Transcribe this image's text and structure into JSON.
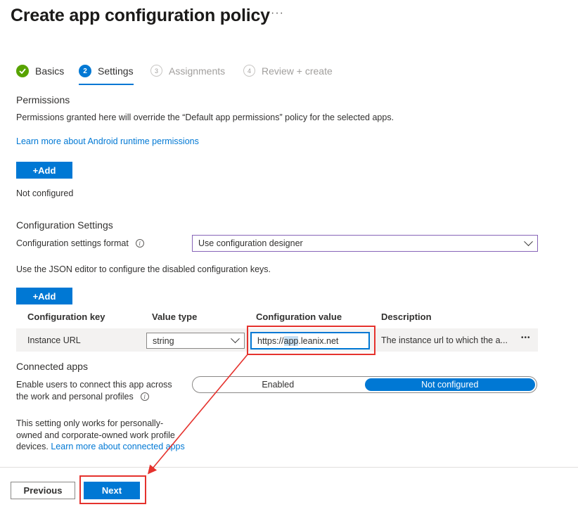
{
  "header": {
    "title": "Create app configuration policy",
    "more_label": "···"
  },
  "steps": [
    {
      "number": "✓",
      "label": "Basics",
      "state": "done"
    },
    {
      "number": "2",
      "label": "Settings",
      "state": "active"
    },
    {
      "number": "3",
      "label": "Assignments",
      "state": "inactive"
    },
    {
      "number": "4",
      "label": "Review + create",
      "state": "inactive"
    }
  ],
  "permissions": {
    "heading": "Permissions",
    "description": "Permissions granted here will override the “Default app permissions” policy for the selected apps.",
    "learn_link": "Learn more about Android runtime permissions",
    "add_label": "+Add",
    "status": "Not configured"
  },
  "config": {
    "heading": "Configuration Settings",
    "format_label": "Configuration settings format",
    "format_value": "Use configuration designer",
    "json_note": "Use the JSON editor to configure the disabled configuration keys.",
    "add_label": "+Add",
    "columns": [
      "Configuration key",
      "Value type",
      "Configuration value",
      "Description"
    ],
    "rows": [
      {
        "key": "Instance URL",
        "value_type": "string",
        "value_prefix": "https://",
        "value_selected": "app",
        "value_suffix": ".leanix.net",
        "description": "The instance url to which the a...",
        "actions_label": "•••"
      }
    ]
  },
  "connected_apps": {
    "heading": "Connected apps",
    "label_line1": "Enable users to connect this app across",
    "label_line2": "the work and personal profiles",
    "options": [
      "Enabled",
      "Not configured"
    ],
    "selected": "Not configured",
    "note_line1": "This setting only works for personally-",
    "note_line2": "owned and corporate-owned work profile",
    "note_line3": "devices.",
    "note_link": "Learn more about connected apps"
  },
  "footer": {
    "previous_label": "Previous",
    "next_label": "Next"
  },
  "colors": {
    "accent": "#0078d4",
    "success": "#57a300",
    "highlight": "#e5322d"
  }
}
